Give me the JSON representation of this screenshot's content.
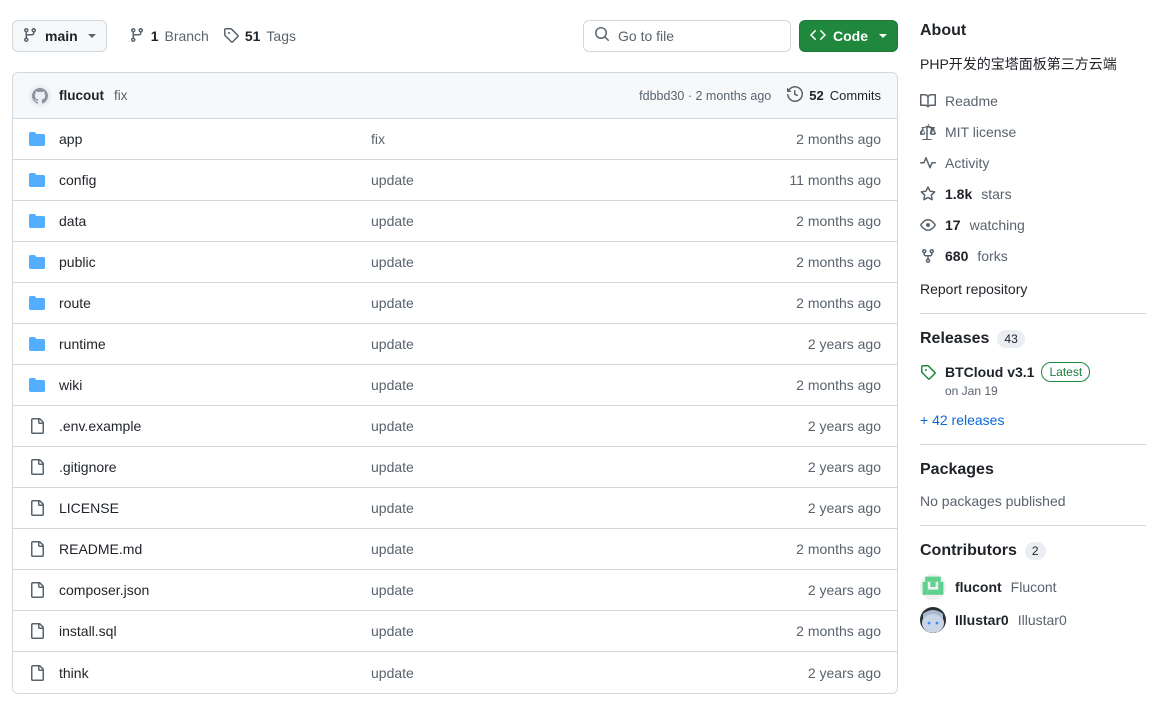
{
  "toolbar": {
    "branch_icon": "git-branch-icon",
    "branch_name": "main",
    "branches_count": "1",
    "branches_label": "Branch",
    "branches_icon": "git-branch-icon",
    "tags_count": "51",
    "tags_label": "Tags",
    "tags_icon": "tag-icon",
    "search_icon": "search-icon",
    "search_placeholder": "Go to file",
    "search_value": "",
    "code_icon": "code-brackets-icon",
    "code_label": "Code"
  },
  "commit_bar": {
    "avatar_icon": "github-mark-avatar",
    "author": "flucout",
    "message": "fix",
    "sha": "fdbbd30",
    "sha_separator": "·",
    "relative_time": "2 months ago",
    "history_icon": "history-clock-icon",
    "commits_count": "52",
    "commits_label": "Commits"
  },
  "files": [
    {
      "icon": "folder-icon",
      "type": "folder",
      "name": "app",
      "message": "fix",
      "age": "2 months ago"
    },
    {
      "icon": "folder-icon",
      "type": "folder",
      "name": "config",
      "message": "update",
      "age": "11 months ago"
    },
    {
      "icon": "folder-icon",
      "type": "folder",
      "name": "data",
      "message": "update",
      "age": "2 months ago"
    },
    {
      "icon": "folder-icon",
      "type": "folder",
      "name": "public",
      "message": "update",
      "age": "2 months ago"
    },
    {
      "icon": "folder-icon",
      "type": "folder",
      "name": "route",
      "message": "update",
      "age": "2 months ago"
    },
    {
      "icon": "folder-icon",
      "type": "folder",
      "name": "runtime",
      "message": "update",
      "age": "2 years ago"
    },
    {
      "icon": "folder-icon",
      "type": "folder",
      "name": "wiki",
      "message": "update",
      "age": "2 months ago"
    },
    {
      "icon": "file-icon",
      "type": "file",
      "name": ".env.example",
      "message": "update",
      "age": "2 years ago"
    },
    {
      "icon": "file-icon",
      "type": "file",
      "name": ".gitignore",
      "message": "update",
      "age": "2 years ago"
    },
    {
      "icon": "file-icon",
      "type": "file",
      "name": "LICENSE",
      "message": "update",
      "age": "2 years ago"
    },
    {
      "icon": "file-icon",
      "type": "file",
      "name": "README.md",
      "message": "update",
      "age": "2 months ago"
    },
    {
      "icon": "file-icon",
      "type": "file",
      "name": "composer.json",
      "message": "update",
      "age": "2 years ago"
    },
    {
      "icon": "file-icon",
      "type": "file",
      "name": "install.sql",
      "message": "update",
      "age": "2 months ago"
    },
    {
      "icon": "file-icon",
      "type": "file",
      "name": "think",
      "message": "update",
      "age": "2 years ago"
    }
  ],
  "sidebar": {
    "about": {
      "title": "About",
      "description": "PHP开发的宝塔面板第三方云端",
      "links": [
        {
          "icon": "book-icon",
          "label": "Readme"
        },
        {
          "icon": "law-icon",
          "label": "MIT license"
        },
        {
          "icon": "pulse-icon",
          "label": "Activity"
        }
      ],
      "stats": [
        {
          "icon": "star-icon",
          "value": "1.8k",
          "label": "stars"
        },
        {
          "icon": "eye-icon",
          "value": "17",
          "label": "watching"
        },
        {
          "icon": "repo-forked-icon",
          "value": "680",
          "label": "forks"
        }
      ],
      "report_link": "Report repository"
    },
    "releases": {
      "title": "Releases",
      "count": "43",
      "tag_icon": "tag-icon",
      "latest_name": "BTCloud v3.1",
      "latest_badge": "Latest",
      "latest_date": "on Jan 19",
      "more_link": "+ 42 releases"
    },
    "packages": {
      "title": "Packages",
      "empty_text": "No packages published"
    },
    "contributors": {
      "title": "Contributors",
      "count": "2",
      "people": [
        {
          "avatar": "identicon-green-avatar",
          "login": "flucont",
          "name": "Flucont"
        },
        {
          "avatar": "anime-photo-avatar",
          "login": "Illustar0",
          "name": "Illustar0"
        }
      ]
    }
  },
  "colors": {
    "accent_green": "#1f883d",
    "link_blue": "#0969da",
    "folder_blue": "#54aeff",
    "muted": "#59636e",
    "border": "#d1d9e0",
    "subtle_bg": "#f6f8fa"
  }
}
